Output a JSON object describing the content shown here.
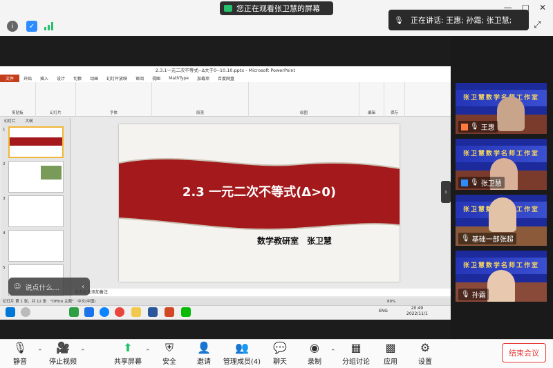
{
  "share_banner": "您正在观看张卫慧的屏幕",
  "speaking": "正在讲话: 王惠; 孙霜; 张卫慧;",
  "window_controls": [
    "—",
    "□",
    "✕"
  ],
  "ppt": {
    "title": "2.3.1一元二次不等式--Δ大于0--10.10.pptx - Microsoft PowerPoint",
    "tabs": [
      "文件",
      "开始",
      "插入",
      "设计",
      "切换",
      "动画",
      "幻灯片放映",
      "审阅",
      "视图",
      "MathType",
      "加载项",
      "百度网盘"
    ],
    "ribbon_groups": [
      "剪贴板",
      "幻灯片",
      "字体",
      "段落",
      "绘图",
      "编辑",
      "保存"
    ],
    "panel_tabs": [
      "幻灯片",
      "大纲"
    ],
    "thumb_numbers": [
      "1",
      "2",
      "3",
      "4",
      "5"
    ],
    "slide_title": "2.3 一元二次不等式(Δ>0)",
    "slide_author": "数学教研室　张卫慧",
    "notes": "单击此处添加备注",
    "status": "幻灯片 第 1 张，共 12 张　\"Office 主题\"　中文(中国)",
    "zoom": "89%",
    "clock_time": "20:49",
    "clock_date": "2022/11/1",
    "lang": "ENG"
  },
  "say_placeholder": "说点什么...",
  "tiles": [
    {
      "name": "王惠",
      "banner": "张卫慧数学名师工作室",
      "color": "#ff7a3d"
    },
    {
      "name": "张卫慧",
      "banner": "张卫慧数学名师工作室",
      "color": "#2d8cff"
    },
    {
      "name": "基础一部张超",
      "banner": "张卫慧数学名师工作室",
      "color": "#555"
    },
    {
      "name": "孙霜",
      "banner": "张卫慧数学名师工作室",
      "color": "#555"
    }
  ],
  "toolbar": {
    "mute": "静音",
    "stop_video": "停止视频",
    "share": "共享屏幕",
    "security": "安全",
    "invite": "邀请",
    "participants": "管理成员(4)",
    "chat": "聊天",
    "record": "录制",
    "breakout": "分组讨论",
    "apps": "应用",
    "settings": "设置",
    "end": "结束会议"
  }
}
